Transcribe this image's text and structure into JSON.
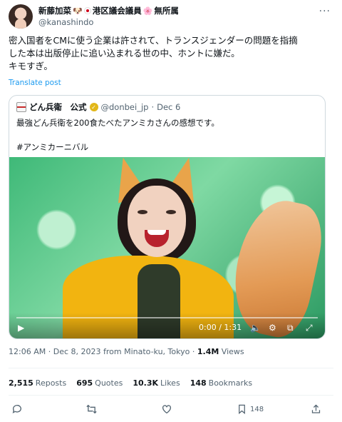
{
  "author": {
    "display_name": "新藤加菜",
    "name_part2": "港区議会議員",
    "name_part3": "無所属",
    "handle": "@kanashindo"
  },
  "tweet": {
    "text": "密入国者をCMに使う企業は許されて、トランスジェンダーの問題を指摘\nした本は出版停止に追い込まれる世の中、ホントに嫌だ。\nキモすぎ。",
    "translate_label": "Translate post"
  },
  "quote": {
    "name": "どん兵衛　公式",
    "handle": "@donbei_jp",
    "separator": "·",
    "date": "Dec 6",
    "text": "最強どん兵衛を200食たべたアンミカさんの感想です。\n\n#アンミカーニバル"
  },
  "video": {
    "time": "0:00 / 1:31"
  },
  "meta": {
    "time": "12:06 AM",
    "sep": "·",
    "date_place": "Dec 8, 2023 from Minato-ku, Tokyo",
    "views_count": "1.4M",
    "views_label": "Views"
  },
  "stats": {
    "reposts_count": "2,515",
    "reposts_label": "Reposts",
    "quotes_count": "695",
    "quotes_label": "Quotes",
    "likes_count": "10.3K",
    "likes_label": "Likes",
    "bookmarks_count": "148",
    "bookmarks_label": "Bookmarks"
  },
  "actions": {
    "bookmark_count": "148"
  },
  "colors": {
    "link": "#1d9bf0",
    "muted": "#536471",
    "text": "#0f1419"
  }
}
